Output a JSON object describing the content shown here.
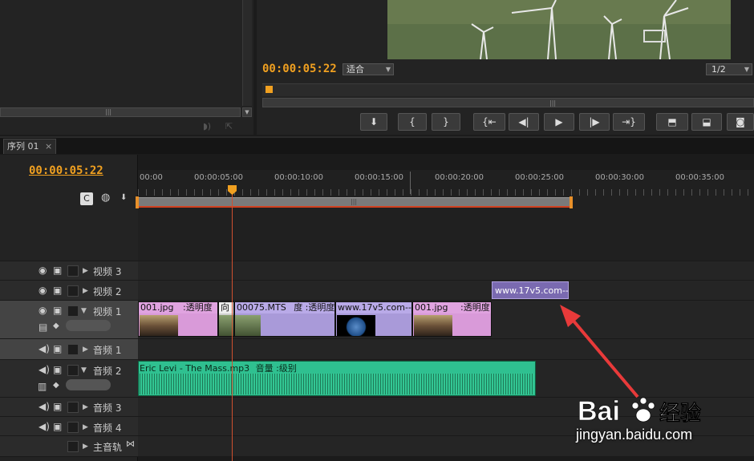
{
  "program": {
    "timecode": "00:00:05:22",
    "fit_label": "适合",
    "resolution_label": "1/2"
  },
  "sequence": {
    "tab_label": "序列",
    "tab_number": "01",
    "timecode": "00:00:05:22",
    "ruler_labels": [
      "00:00",
      "00:00:05:00",
      "00:00:10:00",
      "00:00:15:00",
      "00:00:20:00",
      "00:00:25:00",
      "00:00:30:00",
      "00:00:35:00"
    ]
  },
  "tracks": {
    "video3": "视频 3",
    "video2": "视频 2",
    "video1": "视频 1",
    "audio1": "音频 1",
    "audio2": "音频 2",
    "audio3": "音频 3",
    "audio4": "音频 4",
    "master": "主音轨"
  },
  "clips": {
    "c1": "001.jpg",
    "c1_fx": ":透明度",
    "c2": "向",
    "c3": "00075.MTS",
    "c3_fx": "度 :透明度",
    "c4": "www.17v5.com--",
    "c5": "001.jpg",
    "c5_fx": ":透明度",
    "title": "www.17v5.com--",
    "audio": "Eric Levi - The Mass.mp3",
    "audio_fx": "音量 :级别"
  },
  "watermark": {
    "logo": "Bai 经验",
    "url": "jingyan.baidu.com"
  },
  "colors": {
    "timecode": "#f0a020",
    "playhead": "#d05030",
    "audio_clip": "#2fc090",
    "video_clip_pink": "#d99ad9",
    "title_clip": "#7a6ab0",
    "arrow": "#e83a3a"
  }
}
